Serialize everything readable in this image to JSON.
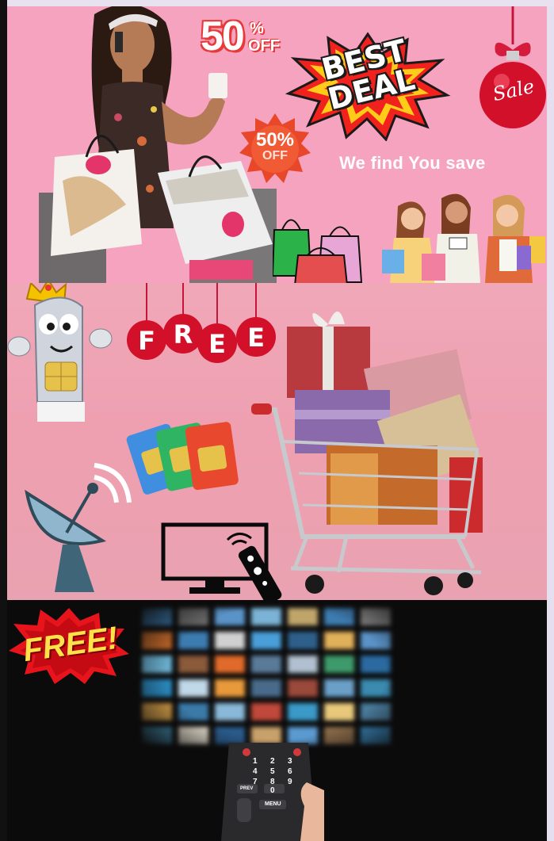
{
  "banner_deal": {
    "discount_number": "50",
    "discount_percent": "%",
    "discount_off": "OFF",
    "best_deal_text": "BEST DEAL",
    "sale_ornament_text": "Sale",
    "burst_percent": "50%",
    "burst_off": "OFF",
    "tagline": "We find You save"
  },
  "banner_free_services": {
    "ornament_letters": [
      "F",
      "R",
      "E",
      "E"
    ]
  },
  "banner_free_tv": {
    "free_badge_text": "FREE!",
    "remote_keys": [
      "1",
      "2",
      "3",
      "4",
      "5",
      "6",
      "7",
      "8",
      "9",
      "PREV",
      "0",
      "MENU"
    ]
  },
  "colors": {
    "banner_pink": "#f6a3c0",
    "accent_red": "#e63a3a",
    "ornament_red": "#d2102a",
    "free_yellow": "#ffe14a"
  }
}
